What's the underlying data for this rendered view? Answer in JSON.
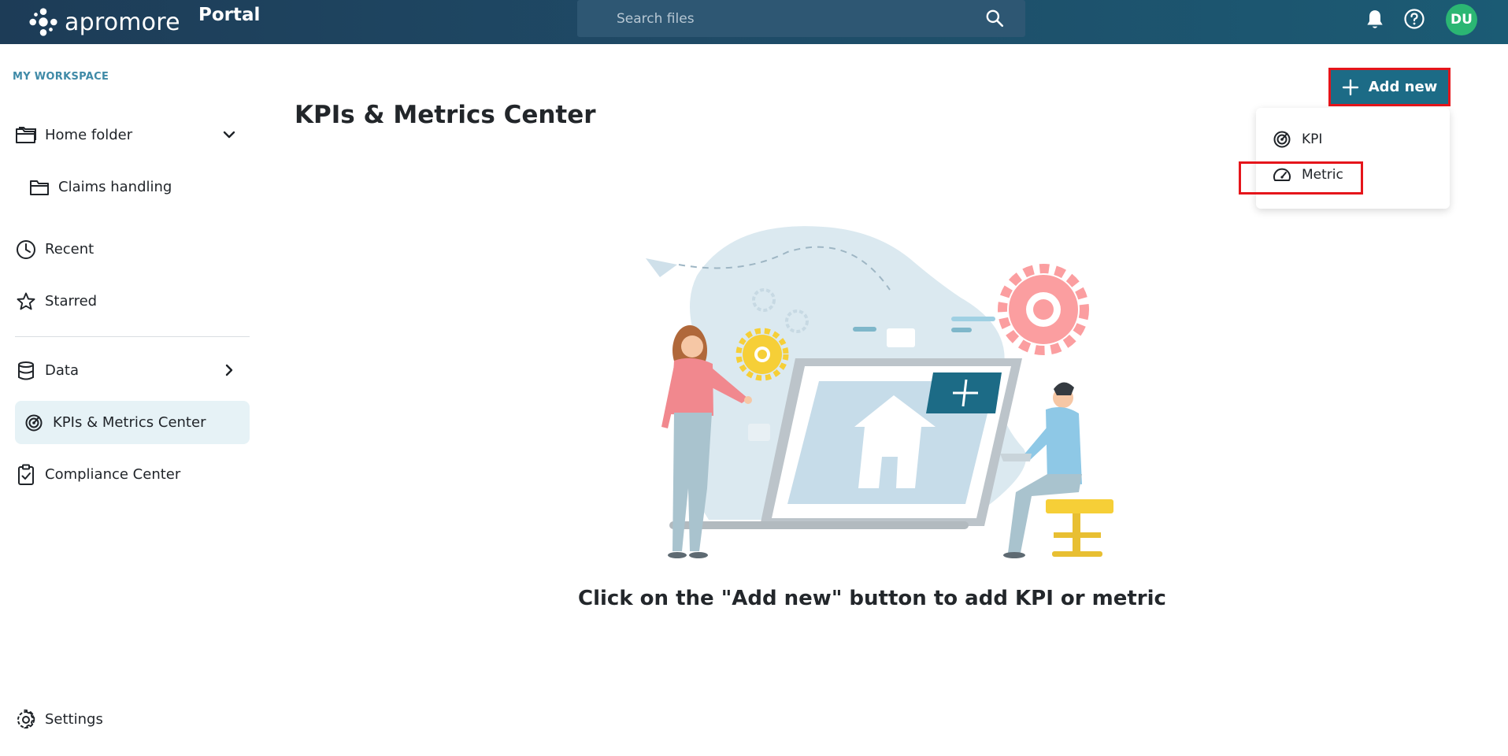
{
  "header": {
    "brand_name": "apromore",
    "section": "Portal",
    "search_placeholder": "Search files",
    "avatar_initials": "DU",
    "avatar_color": "#2bb673"
  },
  "sidebar": {
    "workspace_label": "MY WORKSPACE",
    "items": [
      {
        "label": "Home folder",
        "icon": "folder-open-icon",
        "expanded": true
      },
      {
        "label": "Claims handling",
        "icon": "folder-icon"
      },
      {
        "label": "Recent",
        "icon": "clock-icon"
      },
      {
        "label": "Starred",
        "icon": "star-icon"
      },
      {
        "label": "Data",
        "icon": "database-icon"
      },
      {
        "label": "KPIs & Metrics Center",
        "icon": "target-icon",
        "active": true
      },
      {
        "label": "Compliance Center",
        "icon": "clipboard-check-icon"
      }
    ],
    "settings_label": "Settings"
  },
  "main": {
    "title": "KPIs & Metrics Center",
    "add_button_label": "Add new",
    "add_menu": [
      {
        "label": "KPI",
        "icon": "target-icon"
      },
      {
        "label": "Metric",
        "icon": "gauge-icon",
        "highlighted": true
      }
    ],
    "empty_message": "Click on the \"Add new\" button to add KPI or metric"
  },
  "colors": {
    "topbar": "#1d3c57",
    "accent": "#1c6b86",
    "highlight_border": "#e5151b",
    "active_nav_bg": "#e6f2f6"
  }
}
